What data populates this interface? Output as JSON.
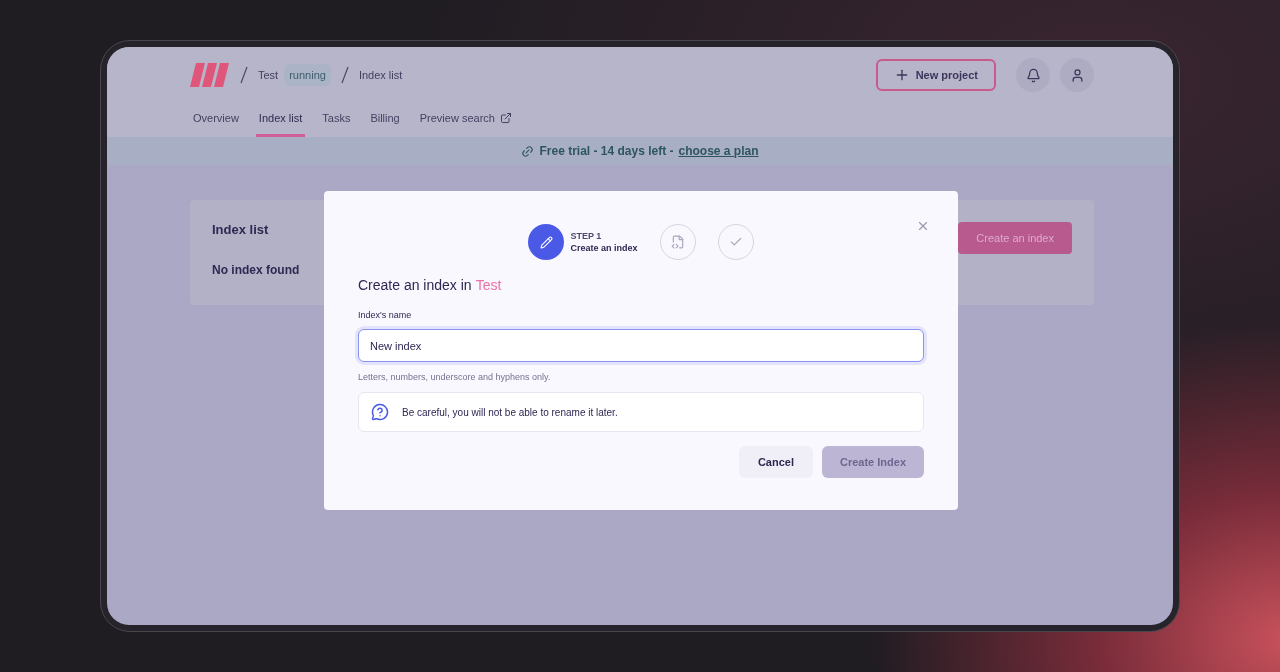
{
  "breadcrumb": {
    "project": "Test",
    "status": "running",
    "page": "Index list"
  },
  "header_actions": {
    "new_project": "New project"
  },
  "tabs": [
    {
      "label": "Overview",
      "selected": false,
      "external": false
    },
    {
      "label": "Index list",
      "selected": true,
      "external": false
    },
    {
      "label": "Tasks",
      "selected": false,
      "external": false
    },
    {
      "label": "Billing",
      "selected": false,
      "external": false
    },
    {
      "label": "Preview search",
      "selected": false,
      "external": true
    }
  ],
  "banner": {
    "text": "Free trial - 14 days left -",
    "link": "choose a plan"
  },
  "card": {
    "title": "Index list",
    "empty_text": "No index found",
    "button": "Create an index"
  },
  "modal": {
    "steps": [
      {
        "kind": "edit",
        "selected": true,
        "label": "STEP 1",
        "sublabel": "Create an index"
      },
      {
        "kind": "code-file",
        "selected": false
      },
      {
        "kind": "check",
        "selected": false
      }
    ],
    "title": "Create an index in",
    "project": "Test",
    "field": {
      "label": "Index's name",
      "value": "New index",
      "hint": "Letters, numbers, underscore and hyphens only."
    },
    "notice": "Be careful, you will not be able to rename it later.",
    "buttons": [
      {
        "label": "Cancel",
        "kind": "secondary",
        "disabled": false
      },
      {
        "label": "Create Index",
        "kind": "primary",
        "disabled": true
      }
    ]
  }
}
